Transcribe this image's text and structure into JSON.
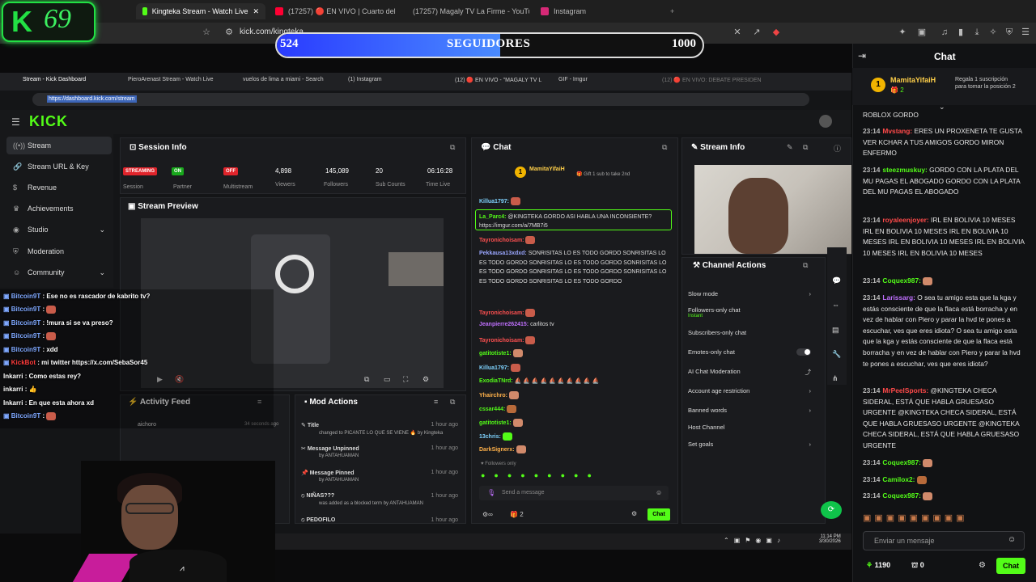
{
  "outer_browser": {
    "tabs": [
      {
        "label": "Kingteka Stream - Watch Live",
        "color": "#53fc18"
      },
      {
        "label": "(17257) 🔴 EN VIVO | Cuarto del",
        "color": "#ff0033"
      },
      {
        "label": "(17257) Magaly TV La Firme - YouTu",
        "color": "#ff0033"
      },
      {
        "label": "Instagram",
        "color": "#d62976"
      }
    ],
    "url": "kick.com/kingteka"
  },
  "logo": {
    "k": "K",
    "number": "69"
  },
  "follower_goal": {
    "current": "524",
    "label": "SEGUIDORES",
    "goal": "1000",
    "progress": 0.524
  },
  "inner_browser": {
    "tabs": [
      "Stream - Kick Dashboard",
      "PieroArenast Stream - Watch Live",
      "vuelos de lima a miami - Search",
      "(1) Instagram",
      "(12) 🔴 EN VIVO - \"MAGALY TV L",
      "GIF - Imgur",
      "(12) 🔴 EN VIVO: DEBATE PRESIDEN"
    ],
    "url": "https://dashboard.kick.com/stream"
  },
  "dashboard": {
    "logo": "KICK",
    "sidebar": [
      {
        "label": "Stream",
        "icon": "signal-icon"
      },
      {
        "label": "Stream URL & Key",
        "icon": "link-icon"
      },
      {
        "label": "Revenue",
        "icon": "dollar-icon"
      },
      {
        "label": "Achievements",
        "icon": "trophy-icon"
      },
      {
        "label": "Studio",
        "icon": "studio-icon"
      },
      {
        "label": "Moderation",
        "icon": "shield-icon"
      },
      {
        "label": "Community",
        "icon": "users-icon"
      }
    ],
    "session_info": {
      "title": "Session Info",
      "stats": [
        {
          "value": "STREAMING",
          "label": "Session"
        },
        {
          "value": "ON",
          "label": "Partner"
        },
        {
          "value": "OFF",
          "label": "Multistream"
        },
        {
          "value": "4,898",
          "label": "Viewers"
        },
        {
          "value": "145,089",
          "label": "Followers"
        },
        {
          "value": "20",
          "label": "Sub Counts"
        },
        {
          "value": "06:16:28",
          "label": "Time Live"
        }
      ]
    },
    "stream_preview": {
      "title": "Stream Preview"
    },
    "activity_feed": {
      "title": "Activity Feed",
      "item_user": "aichoro",
      "item_time": "34 seconds ago"
    },
    "mod_actions": {
      "title": "Mod Actions",
      "items": [
        {
          "title": "Title",
          "detail": "changed to PICANTE LO QUE SE VIENE 🔥 by Kingteka",
          "time": "1 hour ago"
        },
        {
          "title": "Message Unpinned",
          "detail": "by ANTAHUAMAN",
          "time": "1 hour ago"
        },
        {
          "title": "Message Pinned",
          "detail": "by ANTAHUAMAN",
          "time": "1 hour ago"
        },
        {
          "title": "NIÑAS???",
          "detail": "was added as a blocked term by ANTAHUAMAN",
          "time": "1 hour ago"
        },
        {
          "title": "PEDOFILO",
          "detail": "",
          "time": "1 hour ago"
        }
      ]
    },
    "chat": {
      "title": "Chat",
      "pinned_user": "MamitaYifaiH",
      "pinned_text": "Gift 1 sub to take 2nd",
      "messages": [
        {
          "user": "Killua1797:",
          "color": "#7fd3ff",
          "text": ""
        },
        {
          "user": "La_Parc4:",
          "color": "#53fc18",
          "text": "@KINGTEKA GORDO ASI HABLA UNA INCONSIENTE? https://imgur.com/a/7MB7i5"
        },
        {
          "user": "Tayronichoisam:",
          "color": "#ff5050",
          "text": ""
        },
        {
          "user": "Pekkausa13xdxd:",
          "color": "#9aa6ff",
          "text": "SONRISITAS LO ES TODO GORDO SONRISITAS LO ES TODO GORDO SONRISITAS LO ES TODO GORDO SONRISITAS LO ES TODO GORDO SONRISITAS LO ES TODO GORDO SONRISITAS LO ES TODO GORDO SONRISITAS LO ES TODO GORDO"
        },
        {
          "user": "Jeanpierre262415:",
          "color": "#c070ff",
          "text": "carlitos tv"
        },
        {
          "user": "gatitotiste1:",
          "color": "#53fc18",
          "text": ""
        },
        {
          "user": "Killua1797:",
          "color": "#7fd3ff",
          "text": ""
        },
        {
          "user": "ExodiaTNrd:",
          "color": "#53fc18",
          "text": ""
        },
        {
          "user": "Yhairchro:",
          "color": "#ffb14a",
          "text": ""
        },
        {
          "user": "cssar444:",
          "color": "#53fc18",
          "text": ""
        },
        {
          "user": "gatitotiste1:",
          "color": "#53fc18",
          "text": ""
        },
        {
          "user": "13chris:",
          "color": "#7fd3ff",
          "text": ""
        },
        {
          "user": "DarkSignerx:",
          "color": "#ffb14a",
          "text": ""
        }
      ],
      "followers_only": "Followers only",
      "placeholder": "Send a message",
      "count": "2",
      "send": "Chat"
    },
    "stream_info": {
      "title": "Stream Info"
    },
    "channel_actions": {
      "title": "Channel Actions",
      "rows": [
        {
          "label": "Slow mode",
          "sub": ""
        },
        {
          "label": "Followers-only chat",
          "sub": "Instant"
        },
        {
          "label": "Subscribers-only chat",
          "sub": ""
        },
        {
          "label": "Emotes-only chat",
          "sub": ""
        },
        {
          "label": "AI Chat Moderation",
          "sub": ""
        },
        {
          "label": "Account age restriction",
          "sub": ""
        },
        {
          "label": "Banned words",
          "sub": ""
        },
        {
          "label": "Host Channel",
          "sub": ""
        },
        {
          "label": "Set goals",
          "sub": ""
        }
      ]
    },
    "taskbar": {
      "time": "11:14 PM",
      "date": "3/30/2026"
    }
  },
  "overlay_chat": [
    {
      "user": "Bitcoin9T",
      "text": "Ese no es rascador de kabrito tv?",
      "color": "#7fa8ff"
    },
    {
      "user": "Bitcoin9T",
      "text": "",
      "color": "#7fa8ff"
    },
    {
      "user": "Bitcoin9T",
      "text": "!mura si se va preso?",
      "color": "#7fa8ff"
    },
    {
      "user": "Bitcoin9T",
      "text": "",
      "color": "#7fa8ff"
    },
    {
      "user": "Bitcoin9T",
      "text": "xdd",
      "color": "#7fa8ff"
    },
    {
      "user": "KickBot",
      "text": "mi twitter https://x.com/SebaSor45",
      "color": "#ff3b3b"
    },
    {
      "user": "Inkarri",
      "text": "Como estas rey?",
      "color": "#ffffff"
    },
    {
      "user": "inkarri",
      "text": "👍",
      "color": "#ffffff"
    },
    {
      "user": "Inkarri",
      "text": "En que esta ahora xd",
      "color": "#ffffff"
    },
    {
      "user": "Bitcoin9T",
      "text": "",
      "color": "#7fa8ff"
    }
  ],
  "right_chat": {
    "title": "Chat",
    "pinned_user": "MamitaYifaiH",
    "pinned_count": "2",
    "pinned_note": "Regala 1 suscripción para tomar la posición 2",
    "messages": [
      {
        "time": "",
        "user": "",
        "color": "#fff",
        "text": "ROBLOX GORDO"
      },
      {
        "time": "23:14",
        "user": "Mvstang:",
        "color": "#ff4a4a",
        "text": "ERES UN PROXENETA TE GUSTA VER KCHAR A TUS AMIGOS GORDO MIRON ENFERMO"
      },
      {
        "time": "23:14",
        "user": "steezmuskuy:",
        "color": "#53fc18",
        "text": "GORDO CON LA PLATA DEL MU PAGAS EL ABOGADO GORDO CON LA PLATA DEL MU PAGAS EL ABOGADO"
      },
      {
        "time": "23:14",
        "user": "royaleenjoyer:",
        "color": "#ff4a4a",
        "text": "IRL EN BOLIVIA 10 MESES IRL EN BOLIVIA 10 MESES IRL EN BOLIVIA 10 MESES IRL EN BOLIVIA 10 MESES IRL EN BOLIVIA 10 MESES IRL EN BOLIVIA 10 MESES"
      },
      {
        "time": "23:14",
        "user": "Coquex987:",
        "color": "#53fc18",
        "text": ""
      },
      {
        "time": "23:14",
        "user": "Larissarg:",
        "color": "#c070ff",
        "text": "O sea tu amigo esta que la kga y estás consciente de que la flaca está borracha y en vez de hablar con Piero y parar la hvd te pones a escuchar, ves que eres idiota? O sea tu amigo esta que la kga y estás consciente de que la flaca está borracha y en vez de hablar con Piero y parar la hvd te pones a escuchar, ves que eres idiota?"
      },
      {
        "time": "23:14",
        "user": "MrPeelSports:",
        "color": "#ff4a4a",
        "text": "@KINGTEKA CHECA SIDERAL, ESTÁ QUE HABLA GRUESASO URGENTE @KINGTEKA CHECA SIDERAL, ESTÁ QUE HABLA GRUESASO URGENTE @KINGTEKA CHECA SIDERAL, ESTÁ QUE HABLA GRUESASO URGENTE"
      },
      {
        "time": "23:14",
        "user": "Coquex987:",
        "color": "#53fc18",
        "text": ""
      },
      {
        "time": "23:14",
        "user": "Camilox2:",
        "color": "#53fc18",
        "text": ""
      },
      {
        "time": "23:14",
        "user": "Coquex987:",
        "color": "#53fc18",
        "text": ""
      }
    ],
    "placeholder": "Enviar un mensaje",
    "points": "1190",
    "gifts": "0",
    "send": "Chat"
  }
}
